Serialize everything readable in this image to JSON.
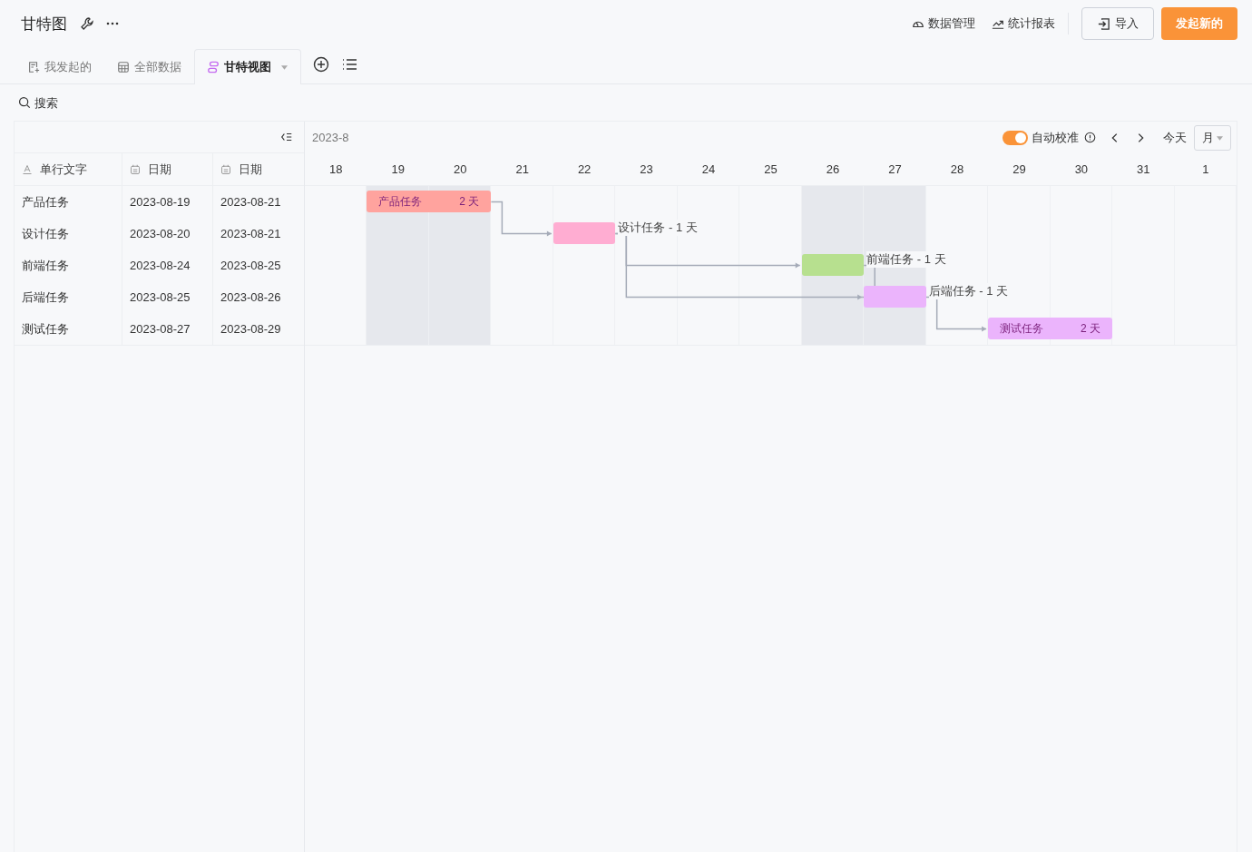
{
  "app": {
    "title": "甘特图"
  },
  "header_links": [
    {
      "label": "数据管理",
      "kind": "gauge"
    },
    {
      "label": "统计报表",
      "kind": "trend"
    }
  ],
  "import_button": "导入",
  "primary_button": "发起新的",
  "tabs": [
    {
      "label": "我发起的",
      "kind": "form",
      "selected": false
    },
    {
      "label": "全部数据",
      "kind": "table",
      "selected": false
    },
    {
      "label": "甘特视图",
      "kind": "gantt",
      "selected": true
    }
  ],
  "search": {
    "placeholder": "搜索"
  },
  "table": {
    "columns": [
      {
        "label": "单行文字",
        "kind": "text"
      },
      {
        "label": "日期",
        "kind": "date"
      },
      {
        "label": "日期",
        "kind": "date"
      }
    ],
    "rows": [
      [
        "产品任务",
        "2023-08-19",
        "2023-08-21"
      ],
      [
        "设计任务",
        "2023-08-20",
        "2023-08-21"
      ],
      [
        "前端任务",
        "2023-08-24",
        "2023-08-25"
      ],
      [
        "后端任务",
        "2023-08-25",
        "2023-08-26"
      ],
      [
        "测试任务",
        "2023-08-27",
        "2023-08-29"
      ]
    ]
  },
  "gantt": {
    "month": "2023-8",
    "auto_calibrate": {
      "label": "自动校准",
      "on": true
    },
    "today": "今天",
    "scale": "月",
    "days": [
      {
        "label": "18",
        "weekend": false
      },
      {
        "label": "19",
        "weekend": true
      },
      {
        "label": "20",
        "weekend": true
      },
      {
        "label": "21",
        "weekend": false
      },
      {
        "label": "22",
        "weekend": false
      },
      {
        "label": "23",
        "weekend": false
      },
      {
        "label": "24",
        "weekend": false
      },
      {
        "label": "25",
        "weekend": false
      },
      {
        "label": "26",
        "weekend": true
      },
      {
        "label": "27",
        "weekend": true
      },
      {
        "label": "28",
        "weekend": false
      },
      {
        "label": "29",
        "weekend": false
      },
      {
        "label": "30",
        "weekend": false
      },
      {
        "label": "31",
        "weekend": false
      },
      {
        "label": "1",
        "weekend": false
      }
    ],
    "bars": [
      {
        "kind": "inside",
        "name": "产品任务",
        "duration": "2 天",
        "color": "#ffa39e"
      },
      {
        "kind": "outside",
        "label": "设计任务 - 1 天",
        "color": "#ffadd2"
      },
      {
        "kind": "outside",
        "label": "前端任务 - 1 天",
        "color": "#b7e08f"
      },
      {
        "kind": "outside",
        "label": "后端任务 - 1 天",
        "color": "#ebb4fc"
      },
      {
        "kind": "inside",
        "name": "测试任务",
        "duration": "2 天",
        "color": "#ebb4fc"
      }
    ]
  }
}
